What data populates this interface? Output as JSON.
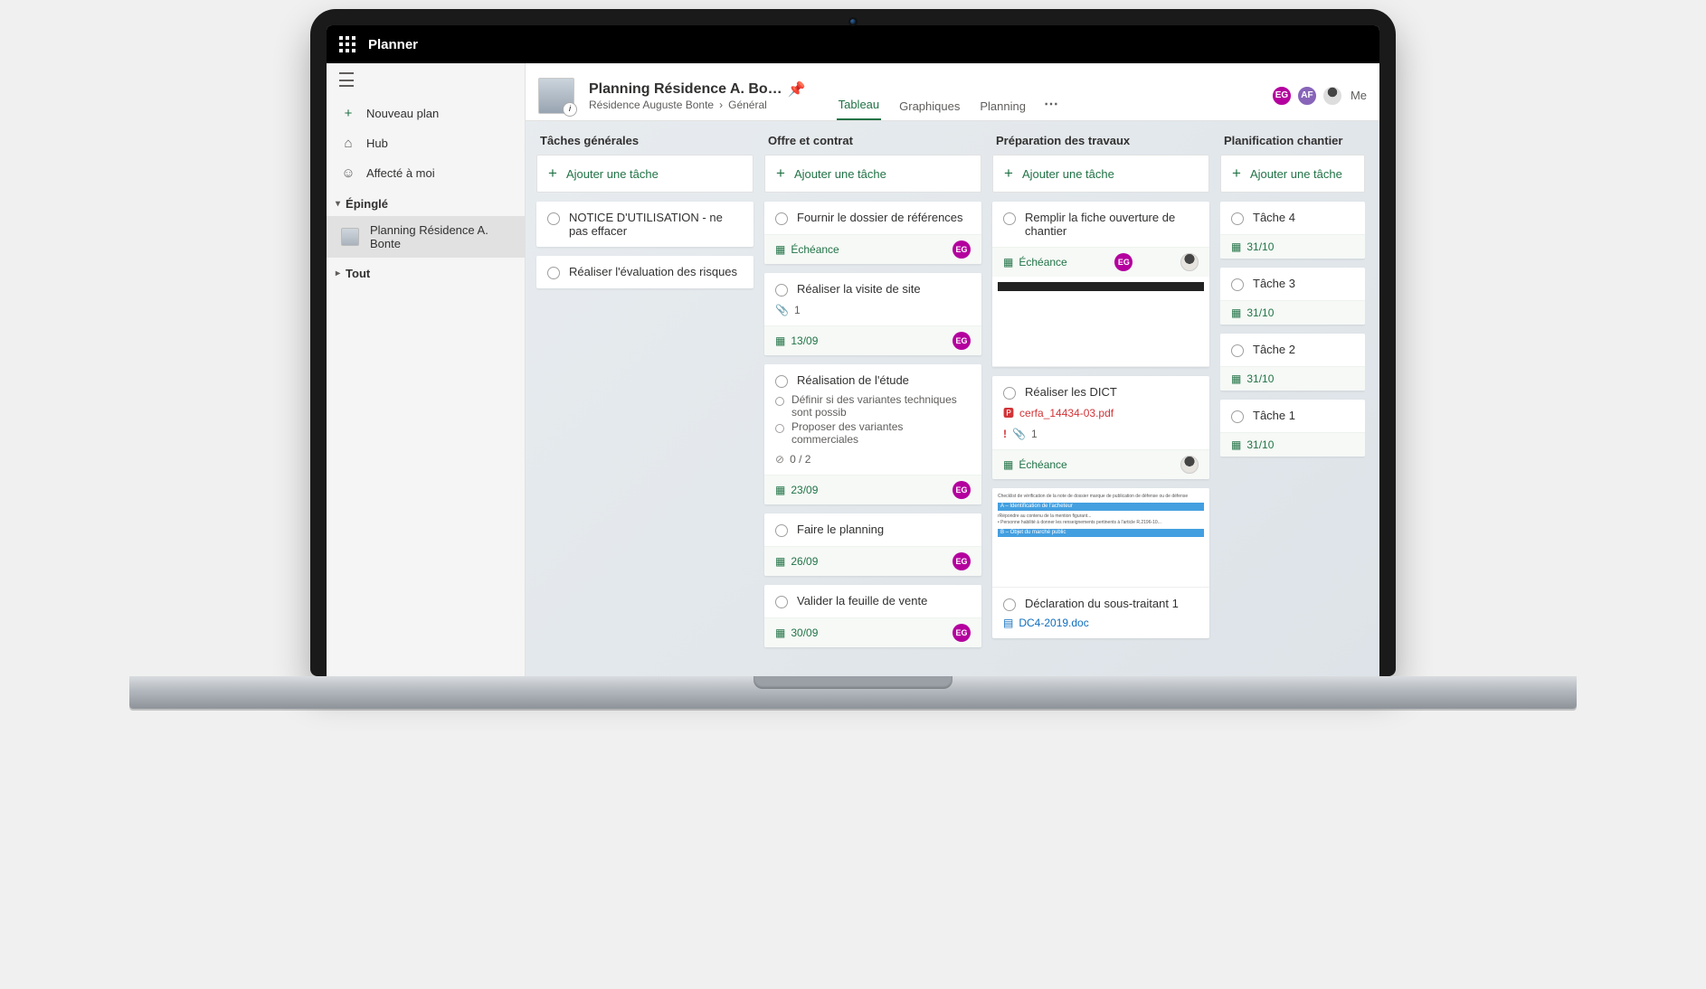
{
  "titlebar": {
    "app_name": "Planner"
  },
  "sidebar": {
    "new_plan": "Nouveau plan",
    "hub": "Hub",
    "assigned": "Affecté à moi",
    "group_pinned": "Épinglé",
    "pinned_plan": "Planning Résidence A. Bonte",
    "group_all": "Tout"
  },
  "header": {
    "plan_title": "Planning Résidence A. Bo…",
    "breadcrumb_parent": "Résidence Auguste Bonte",
    "breadcrumb_child": "Général",
    "tabs": [
      "Tableau",
      "Graphiques",
      "Planning"
    ],
    "active_tab": 0,
    "members_label": "Me",
    "members": [
      {
        "initials": "EG",
        "color": "eg"
      },
      {
        "initials": "AF",
        "color": "af"
      },
      {
        "initials": "",
        "color": "photo"
      }
    ]
  },
  "add_task_label": "Ajouter une tâche",
  "buckets": [
    {
      "name": "Tâches générales",
      "cards": [
        {
          "title": "NOTICE D'UTILISATION - ne pas effacer"
        },
        {
          "title": "Réaliser l'évaluation des risques"
        }
      ]
    },
    {
      "name": "Offre et contrat",
      "cards": [
        {
          "title": "Fournir le dossier de références",
          "footer": "Échéance",
          "footer_badges": [
            "EG"
          ]
        },
        {
          "title": "Réaliser la visite de site",
          "attachments_count": "1",
          "footer": "13/09",
          "footer_badges": [
            "EG"
          ]
        },
        {
          "title": "Réalisation de l'étude",
          "subtasks": [
            "Définir si des variantes techniques sont possib",
            "Proposer des variantes commerciales"
          ],
          "checklist_progress": "0 / 2",
          "footer": "23/09",
          "footer_badges": [
            "EG"
          ]
        },
        {
          "title": "Faire le planning",
          "footer": "26/09",
          "footer_badges": [
            "EG"
          ]
        },
        {
          "title": "Valider la feuille de vente",
          "footer": "30/09",
          "footer_badges": [
            "EG"
          ]
        }
      ]
    },
    {
      "name": "Préparation des travaux",
      "cards": [
        {
          "title": "Remplir la fiche ouverture de chantier",
          "footer": "Échéance",
          "footer_badges": [
            "EG",
            "PHOTO"
          ],
          "has_image": true
        },
        {
          "title": "Réaliser les DICT",
          "attachment_file": "cerfa_14434-03.pdf",
          "attachment_type": "pdf",
          "priority_high": true,
          "attachments_count": "1",
          "footer": "Échéance",
          "footer_badges": [
            "PHOTO"
          ]
        },
        {
          "title": "Déclaration du sous-traitant 1",
          "attachment_file": "DC4-2019.doc",
          "attachment_type": "doc",
          "has_doc_image": true
        }
      ]
    },
    {
      "name": "Planification chantier",
      "cards": [
        {
          "title": "Tâche 4",
          "footer": "31/10"
        },
        {
          "title": "Tâche 3",
          "footer": "31/10"
        },
        {
          "title": "Tâche 2",
          "footer": "31/10"
        },
        {
          "title": "Tâche 1",
          "footer": "31/10"
        }
      ]
    }
  ]
}
